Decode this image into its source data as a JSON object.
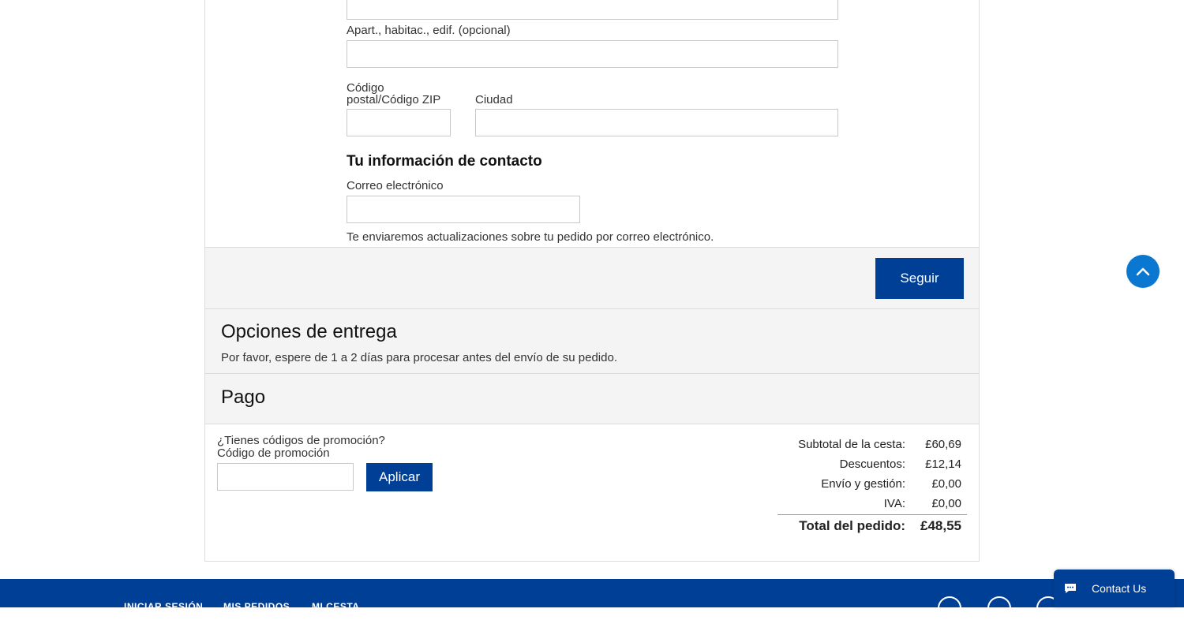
{
  "address": {
    "apt_label": "Apart., habitac., edif. (opcional)",
    "zip_label_line1": "Código",
    "zip_label_line2": "postal/Código ZIP",
    "city_label": "Ciudad"
  },
  "contact": {
    "heading": "Tu información de contacto",
    "email_label": "Correo electrónico",
    "email_note": "Te enviaremos actualizaciones sobre tu pedido por correo electrónico."
  },
  "actions": {
    "continue_label": "Seguir"
  },
  "delivery": {
    "title": "Opciones de entrega",
    "description": "Por favor, espere de 1 a 2 días para procesar antes del envío de su pedido."
  },
  "payment": {
    "title": "Pago"
  },
  "promo": {
    "question": "¿Tienes códigos de promoción?",
    "label": "Código de promoción",
    "apply_label": "Aplicar"
  },
  "summary": {
    "rows": [
      {
        "label": "Subtotal de la cesta:",
        "value": "£60,69"
      },
      {
        "label": "Descuentos:",
        "value": "£12,14"
      },
      {
        "label": "Envío y gestión:",
        "value": "£0,00"
      },
      {
        "label": "IVA:",
        "value": "£0,00"
      }
    ],
    "total_label": "Total del pedido:",
    "total_value": "£48,55"
  },
  "footer": {
    "links": [
      "INICIAR SESIÓN",
      "MIS PEDIDOS",
      "MI CESTA"
    ],
    "social_icons": [
      "facebook-icon",
      "twitter-icon",
      "instagram-icon"
    ]
  },
  "chat": {
    "label": "Contact Us",
    "icon": "chat-bubble-icon"
  },
  "colors": {
    "primary": "#003f96",
    "scroll_top": "#0a78d0",
    "section_bg": "#f4f4f4"
  }
}
